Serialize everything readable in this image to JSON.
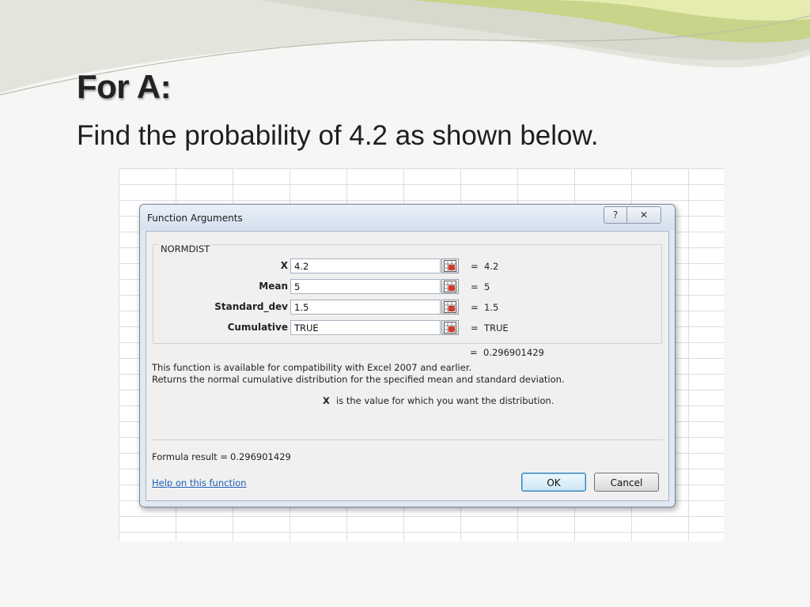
{
  "slide": {
    "title": "For A:",
    "subtitle": "Find the probability of 4.2 as shown below."
  },
  "dialog": {
    "title": "Function Arguments",
    "help_button": "?",
    "close_button": "✕",
    "function_name": "NORMDIST",
    "args": [
      {
        "label": "X",
        "input": "4.2",
        "equals": "=",
        "value": "4.2"
      },
      {
        "label": "Mean",
        "input": "5",
        "equals": "=",
        "value": "5"
      },
      {
        "label": "Standard_dev",
        "input": "1.5",
        "equals": "=",
        "value": "1.5"
      },
      {
        "label": "Cumulative",
        "input": "TRUE",
        "equals": "=",
        "value": "TRUE"
      }
    ],
    "result_equals": "=",
    "result_value": "0.296901429",
    "description_line1": "This function is available for compatibility with Excel 2007 and earlier.",
    "description_line2": "Returns the normal cumulative distribution for the specified mean and standard deviation.",
    "arg_help_name": "X",
    "arg_help_text": "is the value for which you want the distribution.",
    "formula_result_label": "Formula result =",
    "formula_result_value": "0.296901429",
    "help_link": "Help on this function",
    "ok_label": "OK",
    "cancel_label": "Cancel"
  },
  "colors": {
    "link": "#1b5fb8",
    "dialog_frame": "#dfe8f3",
    "wave_green": "#c7d489"
  }
}
